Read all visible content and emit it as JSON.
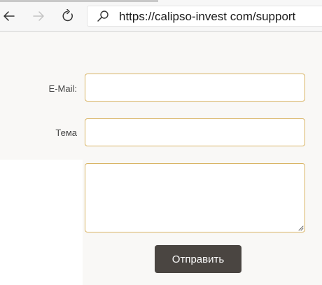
{
  "browser": {
    "url": "https://calipso-invest com/support",
    "icons": {
      "back": "arrow-left-icon",
      "forward": "arrow-right-icon",
      "reload": "reload-icon",
      "search": "search-icon"
    }
  },
  "form": {
    "email_label": "E-Mail:",
    "email_value": "",
    "subject_label": "Тема",
    "subject_value": "",
    "message_value": "",
    "submit_label": "Отправить"
  },
  "colors": {
    "input_border": "#d9b566",
    "button_bg": "#4a4541",
    "form_bg": "#f9f8f6"
  }
}
